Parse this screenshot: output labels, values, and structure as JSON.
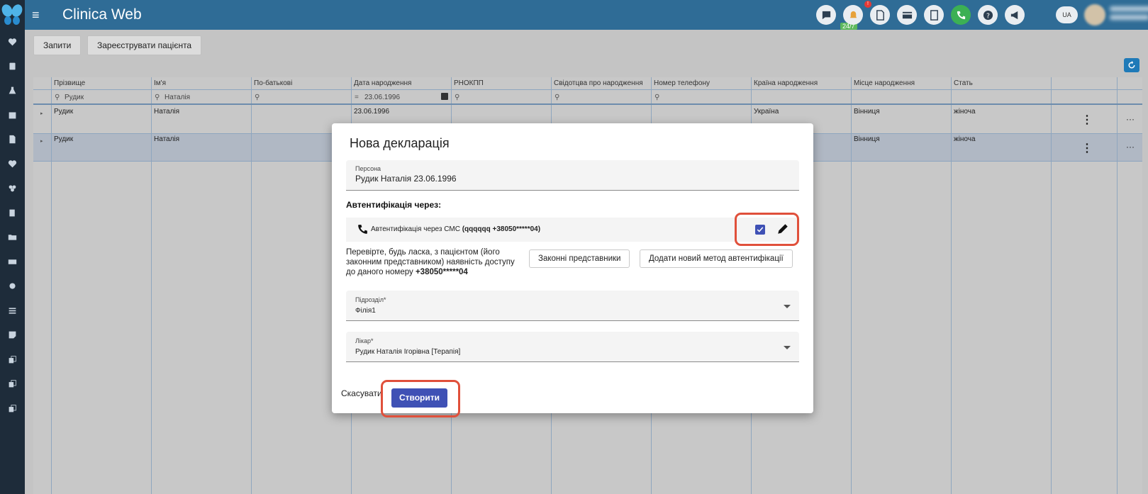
{
  "app": {
    "title": "Clinica Web",
    "lang": "UA",
    "support_badge": "24/7",
    "notif_count": "!"
  },
  "topbar_icons": [
    "chat-icon",
    "notification-icon",
    "pdf-icon",
    "card-icon",
    "calculator-icon",
    "phone-icon",
    "help-icon",
    "megaphone-icon"
  ],
  "sidebar_icons": [
    "heart-icon",
    "contacts-icon",
    "lab-icon",
    "calendar-icon",
    "document-icon",
    "heartbeat-icon",
    "group-icon",
    "book-icon",
    "folder-icon",
    "cash-icon",
    "settings-icon",
    "list-icon",
    "note-icon",
    "copy-icon",
    "copy-icon",
    "copy-icon"
  ],
  "toolbar": {
    "requests_label": "Запити",
    "register_label": "Зареєструвати пацієнта"
  },
  "grid": {
    "columns": [
      "Прізвище",
      "Ім'я",
      "По-батькові",
      "Дата народження",
      "РНОКПП",
      "Свідотцва про народження",
      "Номер телефону",
      "Країна народження",
      "Місце народження",
      "Стать"
    ],
    "filters": {
      "surname": "Рудик",
      "name": "Наталія",
      "dob_op": "=",
      "dob": "23.06.1996"
    },
    "rows": [
      {
        "surname": "Рудик",
        "name": "Наталія",
        "dob": "23.06.1996",
        "country": "Україна",
        "place": "Вінниця",
        "sex": "жіноча",
        "more": "⋮",
        "ellipsis": "···"
      },
      {
        "surname": "Рудик",
        "name": "Наталія",
        "place": "Вінниця",
        "sex": "жіноча",
        "more": "⋮",
        "ellipsis": "···"
      }
    ]
  },
  "modal": {
    "title": "Нова декларація",
    "person_label": "Персона",
    "person_value": "Рудик Наталія  23.06.1996",
    "auth_heading": "Автентифікація через:",
    "auth_method_prefix": "Автентифікація через СМС",
    "auth_method_detail": "(qqqqqq +38050*****04)",
    "auth_selected": true,
    "warning_text": "Перевірте, будь ласка, з пацієнтом (його законним представником) наявність доступу до даного номеру",
    "warning_phone": "+38050*****04",
    "legal_reps_label": "Законні представники",
    "add_auth_label": "Додати новий метод автентифікації",
    "division_label": "Підрозділ*",
    "division_value": "Філія1",
    "doctor_label": "Лікар*",
    "doctor_value": "Рудик Наталія Ігорівна [Терапія]",
    "cancel_label": "Скасувати",
    "create_label": "Створити"
  },
  "colors": {
    "topbar": "#2f6c96",
    "sidebar": "#1e2c3a",
    "primary": "#3f51b5",
    "highlight": "#e0503b"
  }
}
